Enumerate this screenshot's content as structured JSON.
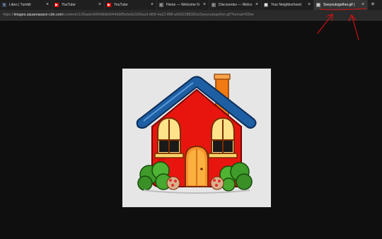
{
  "tabs": [
    {
      "label": "Likes | Tumblr",
      "favicon": "tumblr-icon",
      "color": "#36465d",
      "glyph": "t"
    },
    {
      "label": "YouTube",
      "favicon": "youtube-icon",
      "color": "#ff0000",
      "glyph": "▶"
    },
    {
      "label": "YouTube",
      "favicon": "youtube-icon",
      "color": "#ff0000",
      "glyph": "▶"
    },
    {
      "label": "Home — Welcome N",
      "favicon": "page-icon",
      "color": "#6a6a6a",
      "glyph": "◐"
    },
    {
      "label": "Discoveries — Welco",
      "favicon": "page-icon",
      "color": "#6a6a6a",
      "glyph": "◐"
    },
    {
      "label": "Your Neighborhood",
      "favicon": "page-icon",
      "color": "#6a6a6a",
      "glyph": "▣"
    },
    {
      "label": "Seeyoutogether.gif (",
      "favicon": "globe-icon",
      "color": "#8a8a8a",
      "glyph": "◎"
    }
  ],
  "active_tab_index": 6,
  "new_tab_label": "+",
  "close_label": "×",
  "address": {
    "prefix": "https://",
    "host": "images.squarespace-cdn.com",
    "path": "/content/v1/65ade4904d6db9044b985ebe/b22b5acd-d6f9-4a22-8f9f-a6692288382a/Seeyoutogether.gif?format=500w"
  },
  "image": {
    "subject": "house-illustration"
  },
  "colors": {
    "page_bg": "#0f0f0f",
    "tabbar_bg": "#1f1f1f",
    "annotation": "#d01010",
    "roof": "#1e5fa3",
    "wall": "#e8150f"
  }
}
